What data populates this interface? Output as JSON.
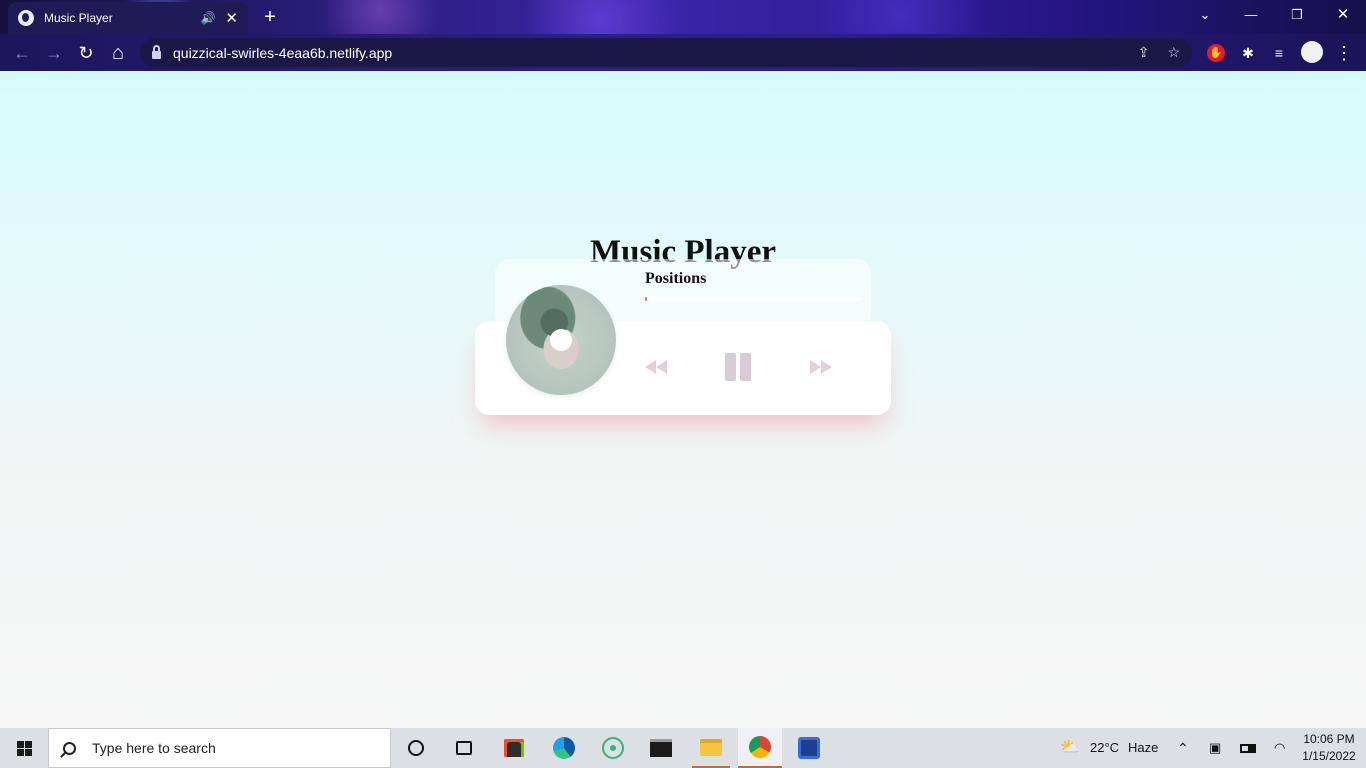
{
  "browser": {
    "tab_title": "Music Player",
    "tab_audio_icon": "speaker-icon",
    "tab_close": "✕",
    "new_tab": "+",
    "url": "quizzical-swirles-4eaa6b.netlify.app",
    "window_controls": {
      "chevron": "⌄",
      "minimize": "—",
      "restore": "❐",
      "close": "✕"
    },
    "nav": {
      "back": "←",
      "forward": "→",
      "reload": "↻",
      "home": "⌂"
    },
    "omnibox_buttons": {
      "share": "⇪",
      "bookmark": "☆"
    },
    "extensions": {
      "adblock": "✋",
      "puzzle": "✱",
      "media": "≡",
      "menu": "⋮"
    }
  },
  "page": {
    "title": "Music Player",
    "player": {
      "song_title": "Positions",
      "progress_percent": 1,
      "controls": {
        "rewind": "rewind-icon",
        "pause": "pause-icon",
        "forward": "fast-forward-icon"
      }
    }
  },
  "taskbar": {
    "search_placeholder": "Type here to search",
    "weather_temp": "22°C",
    "weather_desc": "Haze",
    "time": "10:06 PM",
    "date": "1/15/2022",
    "colors": {
      "accent": "#c96a2d"
    }
  }
}
